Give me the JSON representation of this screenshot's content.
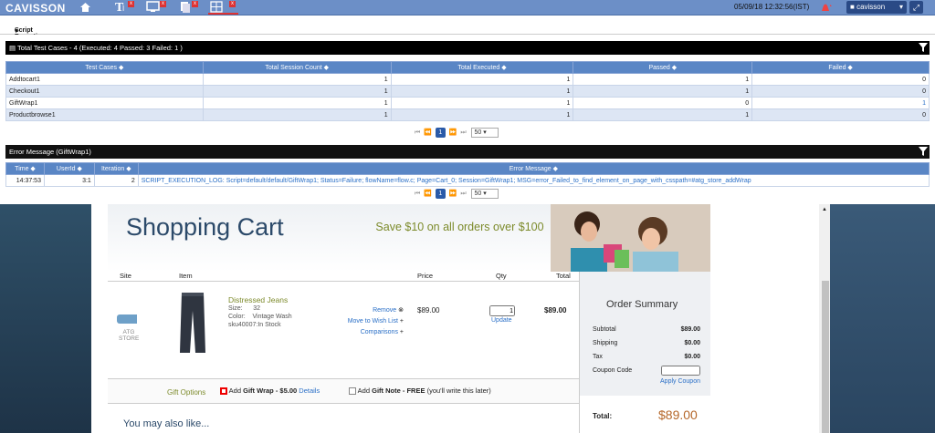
{
  "topbar": {
    "logo": "CAVISSON",
    "datetime": "05/09/18 12:32:56(IST)",
    "user": "cavisson"
  },
  "subbar": {
    "title": "Script Execution Stats"
  },
  "stats": {
    "header": "Total Test Cases - 4 (Executed: 4 Passed: 3 Failed: 1 )",
    "columns": [
      "Test Cases",
      "Total Session Count",
      "Total Executed",
      "Passed",
      "Failed"
    ],
    "rows": [
      [
        "Addtocart1",
        "1",
        "1",
        "1",
        "0"
      ],
      [
        "Checkout1",
        "1",
        "1",
        "1",
        "0"
      ],
      [
        "GiftWrap1",
        "1",
        "1",
        "0",
        "1"
      ],
      [
        "Productbrowse1",
        "1",
        "1",
        "1",
        "0"
      ]
    ],
    "page": "1",
    "page_size": "50"
  },
  "errors": {
    "header": "Error Message (GiftWrap1)",
    "columns": [
      "Time",
      "UserId",
      "Iteration",
      "Error Message"
    ],
    "rows": [
      [
        "14:37:53",
        "3:1",
        "2",
        "SCRIPT_EXECUTION_LOG: Script=default/default/GiftWrap1; Status=Failure; flowName=flow.c; Page=Cart_0; Session=GiftWrap1; MSG=error_Failed_to_find_element_on_page_with_csspath=#atg_store_addWrap"
      ]
    ],
    "page": "1",
    "page_size": "50"
  },
  "shop": {
    "title": "Shopping Cart",
    "promo": "Save $10 on all orders over $100",
    "columns": {
      "site": "Site",
      "item": "Item",
      "price": "Price",
      "qty": "Qty",
      "total": "Total"
    },
    "site_label_1": "ATG",
    "site_label_2": "STORE",
    "product": {
      "name": "Distressed Jeans",
      "size_label": "Size:",
      "size": "32",
      "color_label": "Color:",
      "color": "Vintage Wash",
      "sku": "sku40007:",
      "stock": "In Stock",
      "remove": "Remove",
      "wishlist": "Move to Wish List",
      "comparisons": "Comparisons",
      "price": "$89.00",
      "qty": "1",
      "update": "Update",
      "total": "$89.00"
    },
    "gift_options": "Gift Options",
    "gift_wrap_prefix": "Add",
    "gift_wrap_bold": "Gift Wrap",
    "gift_wrap_price": "- $5.00",
    "details": "Details",
    "gift_note_prefix": "Add",
    "gift_note_bold": "Gift Note",
    "gift_note_free": "- FREE",
    "gift_note_rest": "(you'll write this later)",
    "also_like": "You may also like...",
    "summary": {
      "title": "Order Summary",
      "subtotal_label": "Subtotal",
      "subtotal": "$89.00",
      "shipping_label": "Shipping",
      "shipping": "$0.00",
      "tax_label": "Tax",
      "tax": "$0.00",
      "coupon_label": "Coupon Code",
      "apply": "Apply Coupon",
      "total_label": "Total:",
      "total": "$89.00"
    }
  }
}
